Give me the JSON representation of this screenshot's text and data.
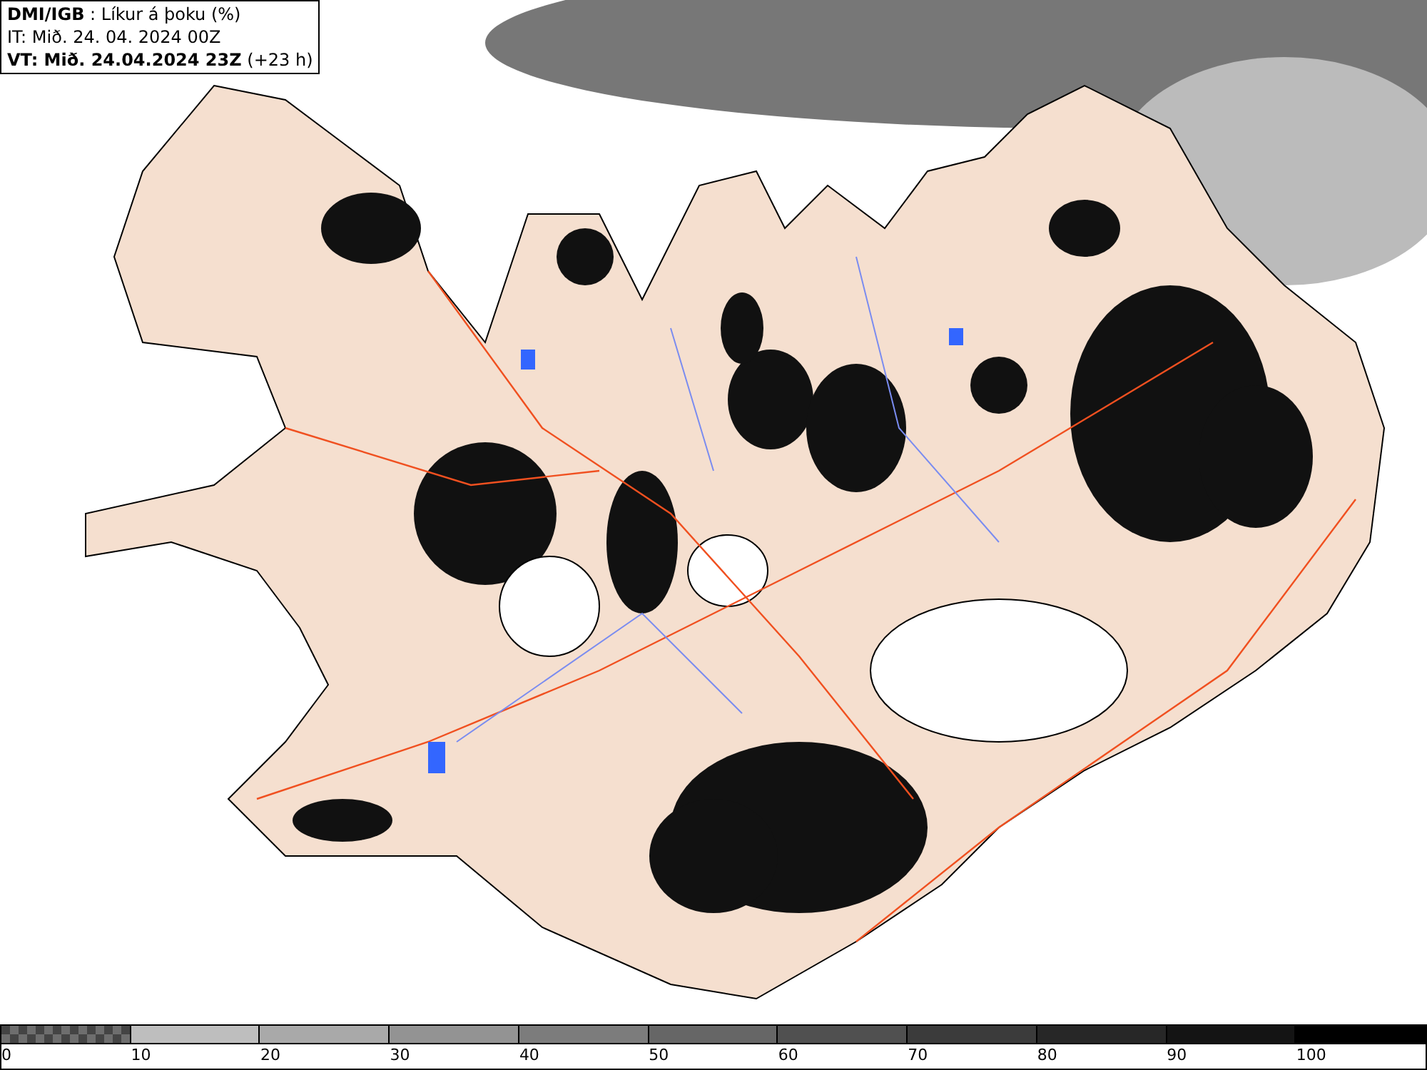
{
  "header": {
    "lines": [
      "**DMI/IGB** : Líkur á þoku (%)",
      "IT: Mið. 24. 04. 2024 00Z",
      "**VT: Mið. 24.04.2024 23Z** (+23 h)"
    ]
  },
  "colorbar": {
    "segments": [
      {
        "label": "0",
        "kind": "checker",
        "color": "#6e6e6e"
      },
      {
        "label": "10",
        "kind": "solid",
        "color": "#bebebe"
      },
      {
        "label": "20",
        "kind": "solid",
        "color": "#a9a9a9"
      },
      {
        "label": "30",
        "kind": "solid",
        "color": "#939393"
      },
      {
        "label": "40",
        "kind": "solid",
        "color": "#7c7c7c"
      },
      {
        "label": "50",
        "kind": "solid",
        "color": "#666666"
      },
      {
        "label": "60",
        "kind": "solid",
        "color": "#505050"
      },
      {
        "label": "70",
        "kind": "solid",
        "color": "#3b3b3b"
      },
      {
        "label": "80",
        "kind": "solid",
        "color": "#272727"
      },
      {
        "label": "90",
        "kind": "solid",
        "color": "#141414"
      },
      {
        "label": "100",
        "kind": "solid",
        "color": "#000000"
      }
    ]
  }
}
